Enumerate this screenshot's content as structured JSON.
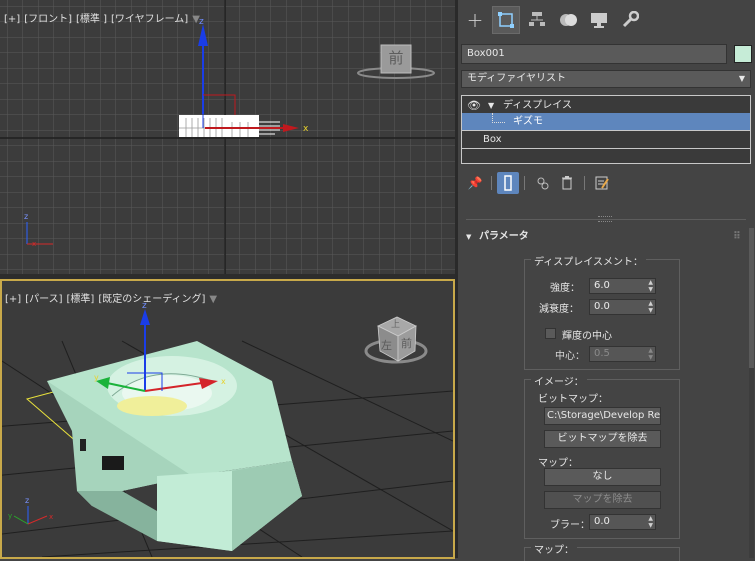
{
  "viewports": {
    "front": {
      "labels": [
        "[+]",
        "[フロント]",
        "[標準 ]",
        "[ワイヤフレーム]"
      ],
      "viewcube_face": "前"
    },
    "perspective": {
      "labels": [
        "[+]",
        "[パース]",
        "[標準]",
        "[既定のシェーディング]"
      ],
      "viewcube_top": "上",
      "viewcube_left": "左",
      "viewcube_front": "前"
    }
  },
  "command_panel": {
    "tabs": [
      {
        "name": "create",
        "icon": "plus-icon"
      },
      {
        "name": "modify",
        "icon": "modify-icon",
        "active": true
      },
      {
        "name": "hierarchy",
        "icon": "hierarchy-icon"
      },
      {
        "name": "motion",
        "icon": "motion-icon"
      },
      {
        "name": "display",
        "icon": "display-icon"
      },
      {
        "name": "utilities",
        "icon": "wrench-icon"
      }
    ],
    "object_name": "Box001",
    "object_color": "#c6ecd7",
    "modifier_list_label": "モディファイヤリスト",
    "stack": {
      "modifier": "ディスプレイス",
      "sub": "ギズモ",
      "base": "Box"
    },
    "rollout_title": "パラメータ",
    "displacement": {
      "title": "ディスプレイスメント：",
      "strength_label": "強度：",
      "strength_value": "6.0",
      "decay_label": "減衰度：",
      "decay_value": "0.0",
      "luminance_center_label": "輝度の中心",
      "center_label": "中心：",
      "center_value": "0.5"
    },
    "image": {
      "title": "イメージ：",
      "bitmap_label": "ビットマップ：",
      "bitmap_path": "C:\\Storage\\Develop Rep",
      "remove_bitmap": "ビットマップを除去",
      "map_label": "マップ：",
      "map_none": "なし",
      "remove_map": "マップを除去",
      "blur_label": "ブラー：",
      "blur_value": "0.0"
    },
    "map_section_title": "マップ："
  }
}
